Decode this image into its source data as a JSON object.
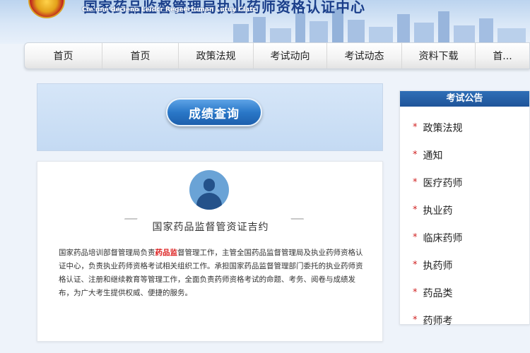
{
  "header": {
    "title": "国家药品监督管理局执业药师资格认证中心",
    "subtitle": "Cie nne decieno Leidcr Regeerfuman Lutuy Clatc"
  },
  "nav": {
    "items": [
      "首页",
      "首页",
      "政策法规",
      "考试动向",
      "考试动态",
      "资料下载",
      "首..."
    ]
  },
  "query": {
    "button_label": "成绩查询"
  },
  "info": {
    "title": "国家药品监督管资证吉约",
    "body_pre": "国家药品培训部督管理局负责",
    "body_hl": "药品监",
    "body_post": "督管理工作，主管全国药品监督管理局及执业药师资格认证中心，负责执业药师资格考试相关组织工作。承担国家药品监督管理部门委托的执业药师资格认证、注册和继续教育等管理工作，全面负责药师资格考试的命题、考务、阅卷与成绩发布，为广大考生提供权威、便捷的服务。"
  },
  "announcements": {
    "title": "考试公告",
    "items": [
      "政策法规",
      "通知",
      "医疗药师",
      "执业药",
      "临床药师",
      "执药师",
      "药品类",
      "药师考"
    ]
  },
  "colors": {
    "nav_text": "#222222",
    "header_title": "#1a3e8a",
    "button_blue": "#2a78c8",
    "announcement_header": "#1f5499",
    "star_red": "#d02020"
  }
}
